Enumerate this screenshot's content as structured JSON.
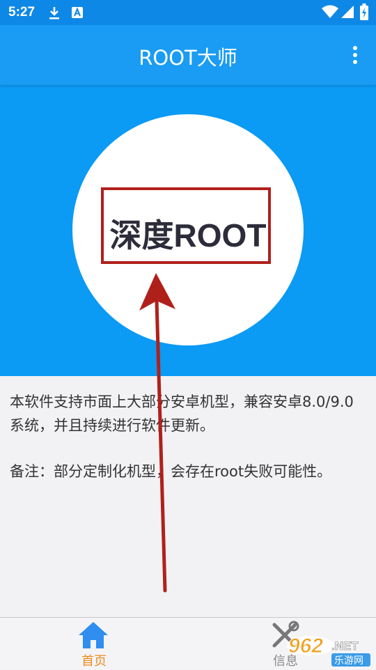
{
  "status_bar": {
    "time": "5:27",
    "icons": [
      "download-icon",
      "font-a-icon",
      "wifi-icon",
      "signal-icon",
      "battery-icon"
    ]
  },
  "app_bar": {
    "title": "ROOT大师",
    "menu_icon": "more-vertical-icon"
  },
  "hero": {
    "label": "深度ROOT"
  },
  "content": {
    "paragraphs": [
      "本软件支持市面上大部分安卓机型，兼容安卓8.0/9.0系统，并且持续进行软件更新。",
      "备注：部分定制化机型，会存在root失败可能性。"
    ]
  },
  "bottom_nav": {
    "items": [
      {
        "label": "首页",
        "icon": "home-icon",
        "active": true
      },
      {
        "label": "信息",
        "icon": "tools-icon",
        "active": false
      }
    ]
  },
  "watermark": {
    "brand": "962",
    "suffix": ".NET",
    "caption": "乐游网"
  },
  "colors": {
    "status_bar": "#0e88e6",
    "app_bar": "#1a9cf4",
    "hero_bg": "#0b9af4",
    "highlight": "#b0201b",
    "nav_active": "#f08a1c",
    "nav_icon_active": "#2f8ef0",
    "nav_inactive": "#888888"
  }
}
